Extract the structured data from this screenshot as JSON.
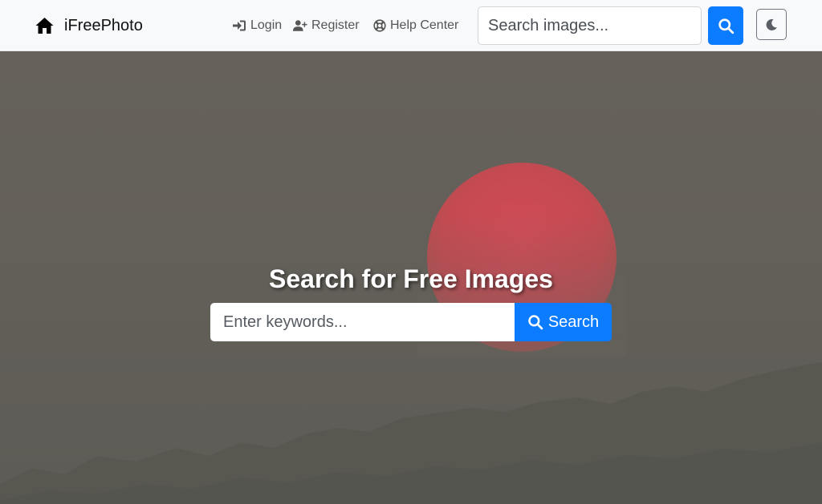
{
  "navbar": {
    "brand": "iFreePhoto",
    "links": [
      {
        "label": "Login",
        "icon": "login-icon"
      },
      {
        "label": "Register",
        "icon": "user-plus-icon"
      },
      {
        "label": "Help Center",
        "icon": "lifebuoy-icon"
      }
    ],
    "search_placeholder": "Search images...",
    "search_button_icon": "search-icon",
    "theme_toggle_icon": "moon-icon"
  },
  "hero": {
    "title": "Search for Free Images",
    "search_placeholder": "Enter keywords...",
    "search_button_label": "Search"
  },
  "colors": {
    "primary": "#0b7bff",
    "navbar_bg": "#f8f9fa",
    "sun": "#c94a54"
  }
}
